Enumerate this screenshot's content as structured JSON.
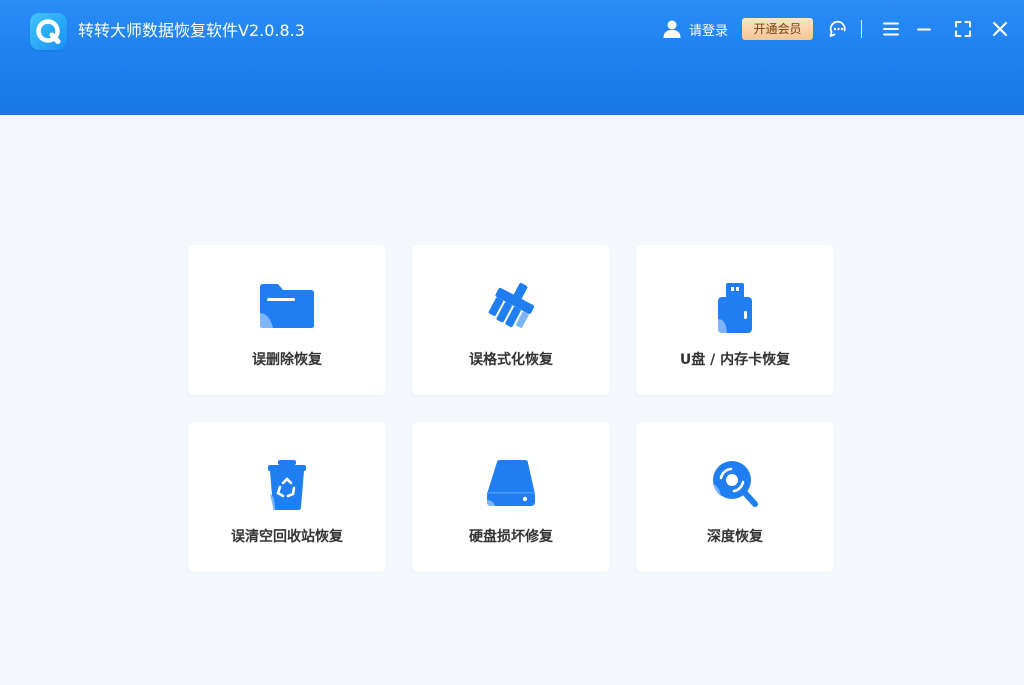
{
  "app": {
    "title": "转转大师数据恢复软件V2.0.8.3",
    "logo_icon": "logo-q-icon"
  },
  "header": {
    "login_label": "请登录",
    "vip_label": "开通会员",
    "controls": [
      "support-icon",
      "menu-icon",
      "minimize-icon",
      "maximize-icon",
      "close-icon"
    ]
  },
  "colors": {
    "header_blue": "#1f82f1",
    "icon_blue": "#1f7ef2",
    "icon_light": "#7fb5f8",
    "vip_gold": "#f6c596",
    "background": "#f4f8fd"
  },
  "cards": [
    {
      "label": "误删除恢复",
      "icon": "folder-icon"
    },
    {
      "label": "误格式化恢复",
      "icon": "broom-icon"
    },
    {
      "label": "U盘 / 内存卡恢复",
      "icon": "usb-drive-icon"
    },
    {
      "label": "误清空回收站恢复",
      "icon": "recycle-bin-icon"
    },
    {
      "label": "硬盘损坏修复",
      "icon": "hard-disk-icon"
    },
    {
      "label": "深度恢复",
      "icon": "deep-scan-icon"
    }
  ]
}
